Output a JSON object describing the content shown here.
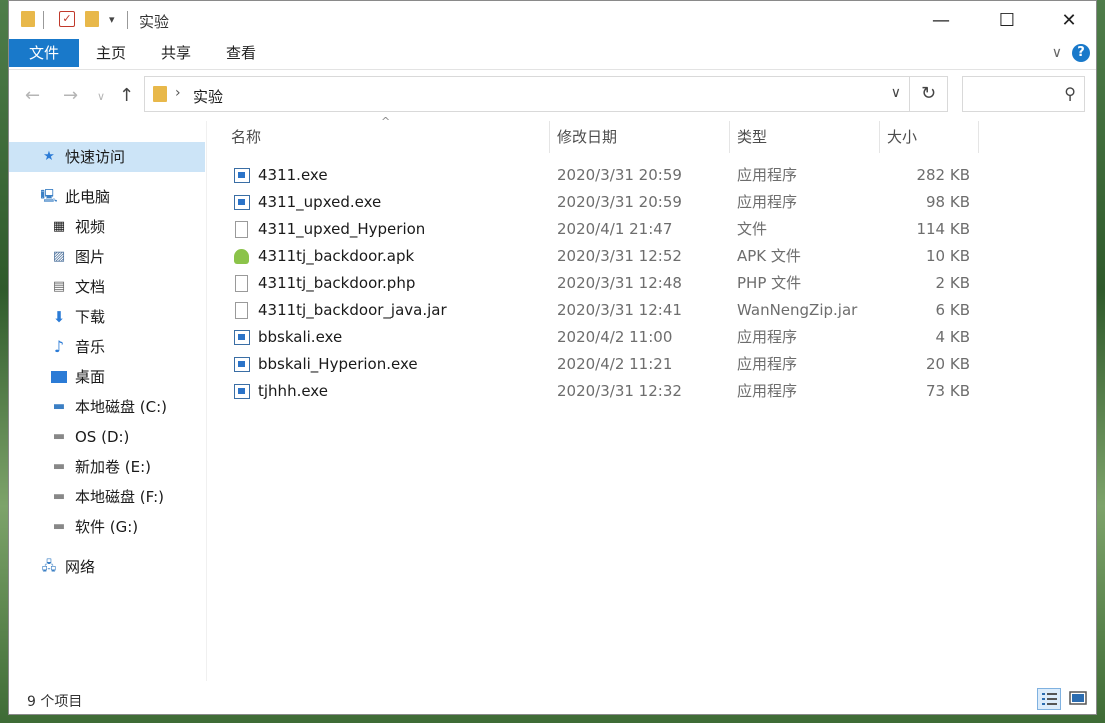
{
  "window": {
    "title": "实验"
  },
  "ribbon": {
    "file": "文件",
    "home": "主页",
    "share": "共享",
    "view": "查看",
    "help": "?"
  },
  "address": {
    "path": "实验"
  },
  "columns": {
    "name": "名称",
    "date": "修改日期",
    "type": "类型",
    "size": "大小"
  },
  "sidebar": {
    "items": [
      {
        "label": "快速访问",
        "icon": "star-icon",
        "selected": true
      },
      {
        "label": "此电脑",
        "icon": "computer-icon"
      },
      {
        "label": "视频",
        "icon": "video-icon"
      },
      {
        "label": "图片",
        "icon": "pictures-icon"
      },
      {
        "label": "文档",
        "icon": "document-icon"
      },
      {
        "label": "下载",
        "icon": "download-icon"
      },
      {
        "label": "音乐",
        "icon": "music-icon"
      },
      {
        "label": "桌面",
        "icon": "desktop-icon"
      },
      {
        "label": "本地磁盘 (C:)",
        "icon": "system-drive-icon"
      },
      {
        "label": "OS (D:)",
        "icon": "drive-icon"
      },
      {
        "label": "新加卷 (E:)",
        "icon": "drive-icon"
      },
      {
        "label": "本地磁盘 (F:)",
        "icon": "drive-icon"
      },
      {
        "label": "软件 (G:)",
        "icon": "drive-icon"
      },
      {
        "label": "网络",
        "icon": "network-icon"
      }
    ]
  },
  "files": [
    {
      "name": "4311.exe",
      "date": "2020/3/31 20:59",
      "type": "应用程序",
      "size": "282 KB",
      "icon": "exe"
    },
    {
      "name": "4311_upxed.exe",
      "date": "2020/3/31 20:59",
      "type": "应用程序",
      "size": "98 KB",
      "icon": "exe"
    },
    {
      "name": "4311_upxed_Hyperion",
      "date": "2020/4/1 21:47",
      "type": "文件",
      "size": "114 KB",
      "icon": "doc"
    },
    {
      "name": "4311tj_backdoor.apk",
      "date": "2020/3/31 12:52",
      "type": "APK 文件",
      "size": "10 KB",
      "icon": "apk"
    },
    {
      "name": "4311tj_backdoor.php",
      "date": "2020/3/31 12:48",
      "type": "PHP 文件",
      "size": "2 KB",
      "icon": "doc"
    },
    {
      "name": "4311tj_backdoor_java.jar",
      "date": "2020/3/31 12:41",
      "type": "WanNengZip.jar",
      "size": "6 KB",
      "icon": "doc"
    },
    {
      "name": "bbskali.exe",
      "date": "2020/4/2 11:00",
      "type": "应用程序",
      "size": "4 KB",
      "icon": "exe"
    },
    {
      "name": "bbskali_Hyperion.exe",
      "date": "2020/4/2 11:21",
      "type": "应用程序",
      "size": "20 KB",
      "icon": "exe"
    },
    {
      "name": "tjhhh.exe",
      "date": "2020/3/31 12:32",
      "type": "应用程序",
      "size": "73 KB",
      "icon": "exe"
    }
  ],
  "status": {
    "count": "9 个项目"
  },
  "colors": {
    "accent": "#1979ca",
    "selection": "#cce4f7"
  }
}
